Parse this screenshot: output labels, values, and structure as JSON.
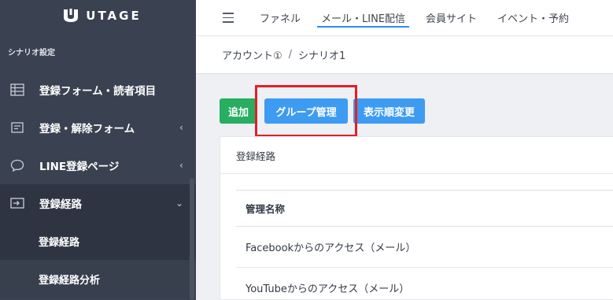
{
  "app": {
    "logo_text": "UTAGE"
  },
  "sidebar": {
    "section_title": "シナリオ設定",
    "items": [
      {
        "label": "登録フォーム・読者項目",
        "icon": "table-icon"
      },
      {
        "label": "登録・解除フォーム",
        "icon": "form-icon",
        "chevron": "‹"
      },
      {
        "label": "LINE登録ページ",
        "icon": "chat-bubble-icon",
        "chevron": "‹"
      },
      {
        "label": "登録経路",
        "icon": "sign-in-icon",
        "chevron": "⌄"
      }
    ],
    "sub_items": [
      {
        "label": "登録経路"
      },
      {
        "label": "登録経路分析"
      }
    ]
  },
  "topnav": {
    "tabs": [
      {
        "label": "ファネル"
      },
      {
        "label": "メール・LINE配信"
      },
      {
        "label": "会員サイト"
      },
      {
        "label": "イベント・予約"
      }
    ]
  },
  "breadcrumb": {
    "account": "アカウント①",
    "separator": "/",
    "scenario": "シナリオ1"
  },
  "toolbar": {
    "add_label": "追加",
    "group_label": "グループ管理",
    "order_label": "表示順変更"
  },
  "panel": {
    "title": "登録経路",
    "table": {
      "header": "管理名称",
      "rows": [
        "Facebookからのアクセス（メール）",
        "YouTubeからのアクセス（メール）"
      ]
    }
  },
  "colors": {
    "sidebar_bg": "#3a4150",
    "accent_blue": "#3d9bf2",
    "add_green": "#27ae60",
    "highlight_red": "#e02128"
  }
}
